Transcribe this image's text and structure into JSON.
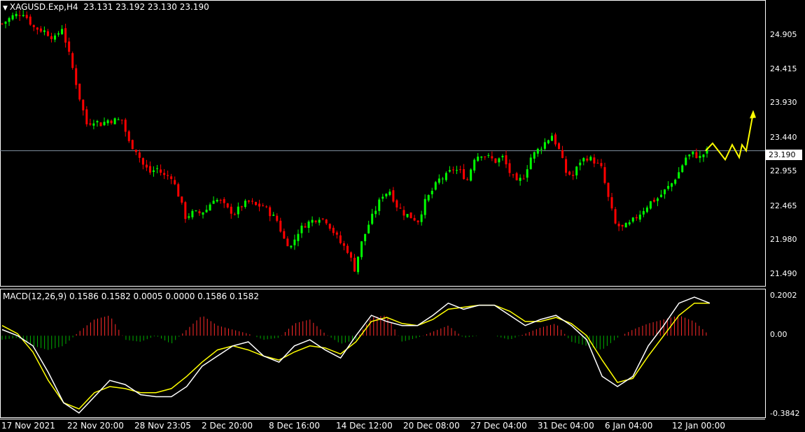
{
  "header": {
    "symbol": "XAGUSD.Exp,H4",
    "ohlc": "23.131 23.192 23.130 23.190"
  },
  "macd": {
    "label": "MACD(12,26,9) 0.1586 0.1582 0.0005 0.0000 0.1586 0.1582",
    "axis_top": "0.2002",
    "axis_mid": "0.00",
    "axis_bottom": "-0.3842"
  },
  "price_axis": {
    "ticks": [
      "24.905",
      "24.415",
      "23.930",
      "23.440",
      "22.955",
      "22.465",
      "21.980",
      "21.490"
    ],
    "current_price": "23.190"
  },
  "time_axis": {
    "ticks": [
      "17 Nov 2021",
      "22 Nov 20:00",
      "28 Nov 23:05",
      "2 Dec 20:00",
      "8 Dec 16:00",
      "14 Dec 12:00",
      "20 Dec 08:00",
      "27 Dec 04:00",
      "31 Dec 04:00",
      "6 Jan 04:00",
      "12 Jan 00:00"
    ]
  },
  "colors": {
    "background": "#000000",
    "bull": "#00ff00",
    "bear": "#ff0000",
    "grid_frame": "#ffffff",
    "macd_line": "#ffffff",
    "signal_line": "#ffff00",
    "hist_pos": "#ff2a2a",
    "hist_neg": "#00b000",
    "arrow": "#ffff00"
  },
  "chart_data": [
    {
      "type": "candlestick",
      "title": "XAGUSD.Exp,H4",
      "ylim": [
        21.38,
        25.2
      ],
      "x_ticks": [
        "17 Nov 2021",
        "22 Nov 20:00",
        "28 Nov 23:05",
        "2 Dec 20:00",
        "8 Dec 16:00",
        "14 Dec 12:00",
        "20 Dec 08:00",
        "27 Dec 04:00",
        "31 Dec 04:00",
        "6 Jan 04:00",
        "12 Jan 00:00"
      ],
      "close_path": [
        [
          0,
          24.9
        ],
        [
          3,
          25.0
        ],
        [
          6,
          25.05
        ],
        [
          9,
          24.85
        ],
        [
          12,
          24.8
        ],
        [
          15,
          24.7
        ],
        [
          17,
          24.85
        ],
        [
          20,
          24.3
        ],
        [
          22,
          23.9
        ],
        [
          24,
          23.55
        ],
        [
          26,
          23.6
        ],
        [
          28,
          23.55
        ],
        [
          30,
          23.6
        ],
        [
          32,
          23.6
        ],
        [
          34,
          23.6
        ],
        [
          36,
          23.3
        ],
        [
          38,
          23.2
        ],
        [
          40,
          23.0
        ],
        [
          42,
          22.9
        ],
        [
          44,
          22.95
        ],
        [
          46,
          22.85
        ],
        [
          48,
          22.85
        ],
        [
          50,
          22.6
        ],
        [
          52,
          22.3
        ],
        [
          54,
          22.35
        ],
        [
          56,
          22.35
        ],
        [
          58,
          22.4
        ],
        [
          60,
          22.55
        ],
        [
          62,
          22.5
        ],
        [
          64,
          22.4
        ],
        [
          66,
          22.35
        ],
        [
          68,
          22.45
        ],
        [
          70,
          22.5
        ],
        [
          72,
          22.45
        ],
        [
          74,
          22.45
        ],
        [
          76,
          22.35
        ],
        [
          78,
          22.25
        ],
        [
          80,
          22.0
        ],
        [
          82,
          21.9
        ],
        [
          84,
          22.1
        ],
        [
          86,
          22.2
        ],
        [
          88,
          22.25
        ],
        [
          90,
          22.3
        ],
        [
          92,
          22.25
        ],
        [
          94,
          22.1
        ],
        [
          96,
          21.95
        ],
        [
          98,
          21.85
        ],
        [
          100,
          21.6
        ],
        [
          102,
          21.95
        ],
        [
          104,
          22.2
        ],
        [
          106,
          22.4
        ],
        [
          108,
          22.6
        ],
        [
          110,
          22.65
        ],
        [
          112,
          22.45
        ],
        [
          114,
          22.35
        ],
        [
          116,
          22.3
        ],
        [
          118,
          22.25
        ],
        [
          120,
          22.5
        ],
        [
          122,
          22.65
        ],
        [
          124,
          22.8
        ],
        [
          126,
          22.85
        ],
        [
          128,
          22.95
        ],
        [
          130,
          22.9
        ],
        [
          132,
          22.8
        ],
        [
          134,
          23.1
        ],
        [
          136,
          23.15
        ],
        [
          138,
          23.1
        ],
        [
          140,
          23.05
        ],
        [
          142,
          23.1
        ],
        [
          144,
          22.9
        ],
        [
          146,
          22.75
        ],
        [
          148,
          22.85
        ],
        [
          150,
          23.1
        ],
        [
          152,
          23.2
        ],
        [
          154,
          23.3
        ],
        [
          156,
          23.4
        ],
        [
          158,
          23.2
        ],
        [
          160,
          22.9
        ],
        [
          162,
          22.85
        ],
        [
          164,
          23.05
        ],
        [
          166,
          23.1
        ],
        [
          168,
          23.05
        ],
        [
          170,
          22.95
        ],
        [
          172,
          22.55
        ],
        [
          174,
          22.2
        ],
        [
          176,
          22.15
        ],
        [
          178,
          22.2
        ],
        [
          180,
          22.3
        ],
        [
          182,
          22.4
        ],
        [
          184,
          22.5
        ],
        [
          186,
          22.55
        ],
        [
          188,
          22.65
        ],
        [
          190,
          22.75
        ],
        [
          192,
          22.9
        ],
        [
          194,
          23.1
        ],
        [
          196,
          23.15
        ],
        [
          198,
          23.1
        ],
        [
          200,
          23.19
        ]
      ],
      "projection_arrow": [
        [
          23.19
        ],
        [
          23.29
        ],
        [
          23.07
        ],
        [
          23.27
        ],
        [
          23.1
        ],
        [
          23.27
        ],
        [
          23.19
        ],
        [
          23.7
        ]
      ],
      "current_price": 23.19
    },
    {
      "type": "line",
      "title": "MACD(12,26,9)",
      "ylim": [
        -0.3842,
        0.2002
      ],
      "series": [
        {
          "name": "MACD",
          "values": [
            0.03,
            0.0,
            -0.05,
            -0.18,
            -0.33,
            -0.38,
            -0.3,
            -0.22,
            -0.24,
            -0.29,
            -0.3,
            -0.3,
            -0.25,
            -0.15,
            -0.1,
            -0.05,
            -0.03,
            -0.1,
            -0.13,
            -0.05,
            -0.02,
            -0.07,
            -0.11,
            0.0,
            0.1,
            0.07,
            0.05,
            0.05,
            0.1,
            0.16,
            0.13,
            0.15,
            0.15,
            0.1,
            0.05,
            0.08,
            0.1,
            0.05,
            -0.02,
            -0.2,
            -0.25,
            -0.2,
            -0.05,
            0.05,
            0.16,
            0.19,
            0.16
          ]
        },
        {
          "name": "Signal",
          "values": [
            0.05,
            0.01,
            -0.08,
            -0.22,
            -0.33,
            -0.36,
            -0.28,
            -0.25,
            -0.26,
            -0.28,
            -0.28,
            -0.26,
            -0.2,
            -0.13,
            -0.07,
            -0.05,
            -0.07,
            -0.1,
            -0.12,
            -0.08,
            -0.05,
            -0.06,
            -0.09,
            -0.03,
            0.07,
            0.09,
            0.06,
            0.05,
            0.08,
            0.13,
            0.14,
            0.15,
            0.15,
            0.12,
            0.07,
            0.07,
            0.09,
            0.06,
            0.0,
            -0.12,
            -0.23,
            -0.21,
            -0.1,
            0.0,
            0.1,
            0.16,
            0.16
          ]
        }
      ],
      "histogram": [
        -0.02,
        -0.01,
        -0.05,
        -0.07,
        -0.05,
        0.02,
        0.08,
        0.1,
        -0.02,
        -0.03,
        0.0,
        -0.04,
        0.03,
        0.1,
        0.05,
        0.03,
        0.01,
        -0.02,
        -0.01,
        0.06,
        0.08,
        0.01,
        -0.04,
        -0.02,
        0.09,
        0.1,
        -0.03,
        -0.01,
        0.02,
        0.05,
        -0.01,
        0.0,
        0.0,
        -0.02,
        0.01,
        0.04,
        0.06,
        -0.03,
        -0.05,
        -0.07,
        -0.01,
        0.03,
        0.06,
        0.08,
        0.1,
        0.07,
        0.0
      ]
    }
  ]
}
